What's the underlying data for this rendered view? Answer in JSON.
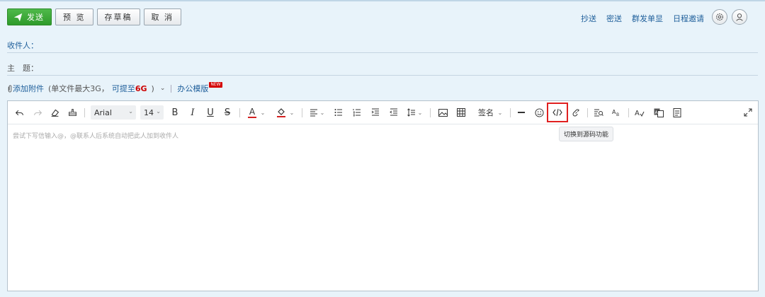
{
  "toolbar": {
    "send_label": "发送",
    "preview_label": "预 览",
    "draft_label": "存草稿",
    "cancel_label": "取 消"
  },
  "header_links": {
    "cc": "抄送",
    "bcc": "密送",
    "group_send": "群发单显",
    "schedule_invite": "日程邀请"
  },
  "form": {
    "to_label": "收件人：",
    "subject_label": "主　题：",
    "to_value": "",
    "subject_value": ""
  },
  "attachment": {
    "add_label": "添加附件",
    "hint_prefix": "(单文件最大3G，",
    "hint_link": "可提至",
    "hint_size": "6G",
    "hint_suffix": ")",
    "template_label": "办公模版",
    "new_badge": "NEW"
  },
  "editor": {
    "font_family": "Arial",
    "font_size": "14",
    "bold": "B",
    "italic": "I",
    "underline": "U",
    "strike": "S",
    "font_color": "A",
    "signature": "签名",
    "tooltip": "切换到源码功能",
    "placeholder": "尝试下写信输入@，@联系人后系统自动把此人加到收件人"
  },
  "colors": {
    "accent_link": "#1f5f9b",
    "send_green": "#3aa835",
    "highlight_red": "#e02020"
  }
}
